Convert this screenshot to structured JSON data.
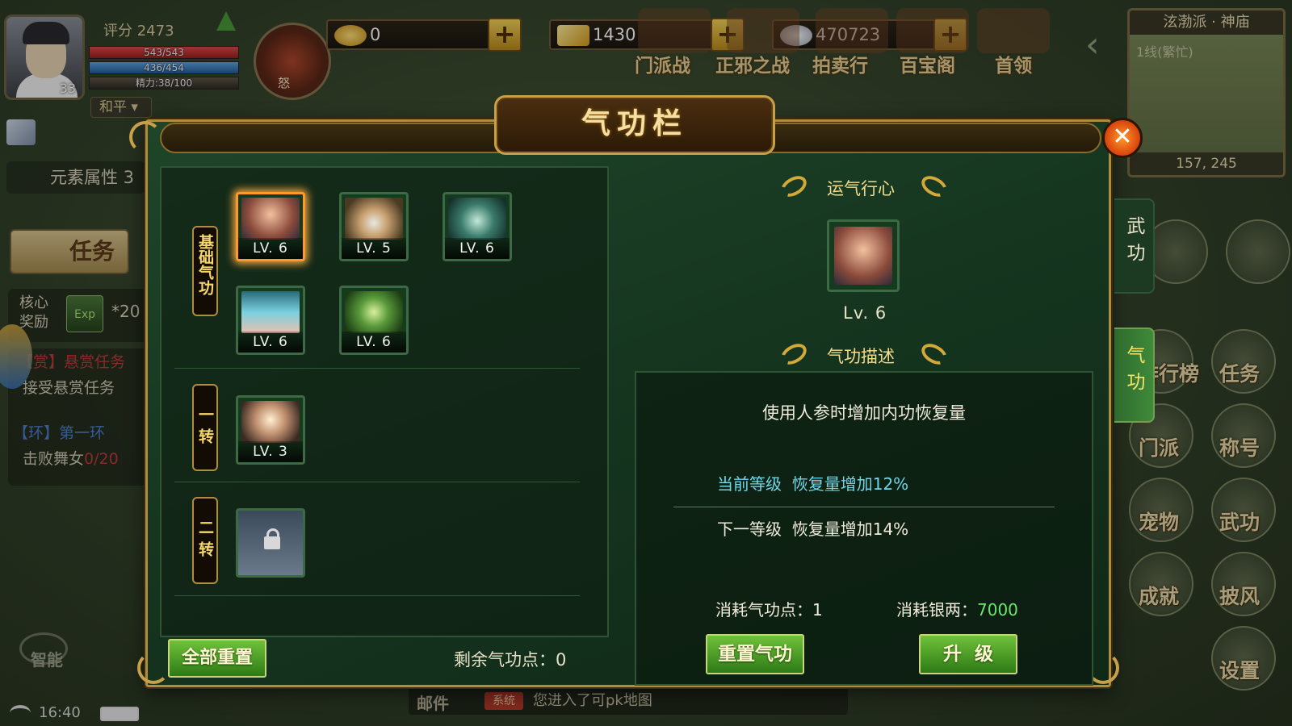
{
  "player": {
    "level": "33",
    "score": "评分 2473",
    "hp": "543/543",
    "mp": "436/454",
    "energy": "精力:38/100",
    "mode": "和平",
    "rage_label": "怒"
  },
  "currencies": {
    "gold_ingot": "0",
    "gold_bar": "1430",
    "silver": "470723"
  },
  "top_menu": [
    "门派战",
    "正邪之战",
    "拍卖行",
    "百宝阁",
    "首领"
  ],
  "minimap": {
    "title": "泫渤派 · 神庙",
    "line": "1线(繁忙)",
    "coords": "157, 245"
  },
  "left_hud": {
    "element_attr": "元素属性  3",
    "task_button": "任务",
    "core_reward_label": "核心奖励",
    "exp_label": "Exp",
    "core_reward_mult": "*20",
    "quest1_title": "【赏】悬赏任务",
    "quest1_desc": "接受悬赏任务",
    "quest2_title": "【环】第一环",
    "quest2_progress_prefix": "击败舞女",
    "quest2_progress": "0/20",
    "smart_label": "智能",
    "time": "16:40"
  },
  "right_hud": {
    "items": [
      "排行榜",
      "任务",
      "门派",
      "称号",
      "宠物",
      "武功",
      "成就",
      "披风",
      "设置"
    ]
  },
  "chat": {
    "mail_label": "邮件",
    "sys_tag": "系统",
    "message": "您进入了可pk地图"
  },
  "modal": {
    "title": "气功栏",
    "close": "✕",
    "side_tabs": [
      {
        "label": "武功",
        "active": false
      },
      {
        "label": "气功",
        "active": true
      }
    ],
    "sections": [
      {
        "label": "基础气功"
      },
      {
        "label": "一转"
      },
      {
        "label": "二转"
      }
    ],
    "skills": [
      {
        "lv": "LV. 6",
        "icon": "qi-meridian-icon",
        "selected": true
      },
      {
        "lv": "LV. 5",
        "icon": "golden-orb-icon",
        "selected": false
      },
      {
        "lv": "LV. 6",
        "icon": "qi-jar-icon",
        "selected": false
      },
      {
        "lv": "LV. 6",
        "icon": "palm-light-icon",
        "selected": false
      },
      {
        "lv": "LV. 6",
        "icon": "green-beads-icon",
        "selected": false
      },
      {
        "lv": "LV. 3",
        "icon": "radiant-figure-icon",
        "selected": false
      },
      {
        "lv": "",
        "icon": "lock-icon",
        "locked": true
      }
    ],
    "reset_all_button": "全部重置",
    "remaining_points": "剩余气功点：0",
    "detail": {
      "header_circulate": "运气行心",
      "level": "Lv. 6",
      "header_desc": "气功描述",
      "description": "使用人参时增加内功恢复量",
      "current_level_label": "当前等级",
      "current_level_effect": "恢复量增加12%",
      "next_level_label": "下一等级",
      "next_level_effect": "恢复量增加14%",
      "cost_points_label": "消耗气功点：",
      "cost_points": "1",
      "cost_silver_label": "消耗银两：",
      "cost_silver": "7000",
      "reset_button": "重置气功",
      "upgrade_button": "升  级"
    }
  },
  "colors": {
    "accent_gold": "#c9a04a",
    "panel_green": "#163620",
    "current_level_cyan": "#6fd7e8",
    "silver_cost_green": "#6ae86a",
    "selected_glow": "#ff9a2a"
  }
}
